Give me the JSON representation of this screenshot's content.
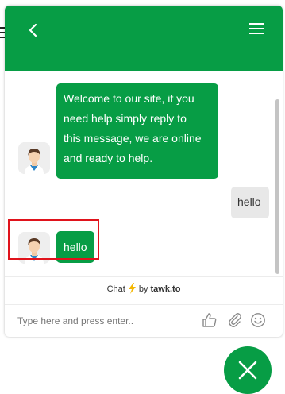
{
  "header": {
    "background": "#079d45",
    "back_icon": "chevron-left-icon",
    "menu_icon": "hamburger-menu-icon"
  },
  "messages": [
    {
      "sender": "agent",
      "lines": [
        "Welcome to our site, if you",
        "need help simply reply to",
        "this message, we are online",
        "and ready to help."
      ],
      "avatar": "agent-avatar"
    },
    {
      "sender": "visitor",
      "text": "hello"
    },
    {
      "sender": "agent",
      "text": "hello",
      "avatar": "agent-avatar",
      "highlighted": true
    }
  ],
  "footer": {
    "powered_prefix": "Chat",
    "powered_by": "by",
    "brand": "tawk.to",
    "bolt_color": "#f5b700"
  },
  "composer": {
    "placeholder": "Type here and press enter..",
    "value": "",
    "icons": [
      "thumbs-up-icon",
      "paperclip-icon",
      "emoji-icon"
    ]
  },
  "launcher": {
    "icon": "close-icon",
    "color": "#079d45"
  },
  "colors": {
    "accent": "#079d45",
    "highlight": "#e0131c",
    "visitor_bubble": "#e8e8e8"
  }
}
